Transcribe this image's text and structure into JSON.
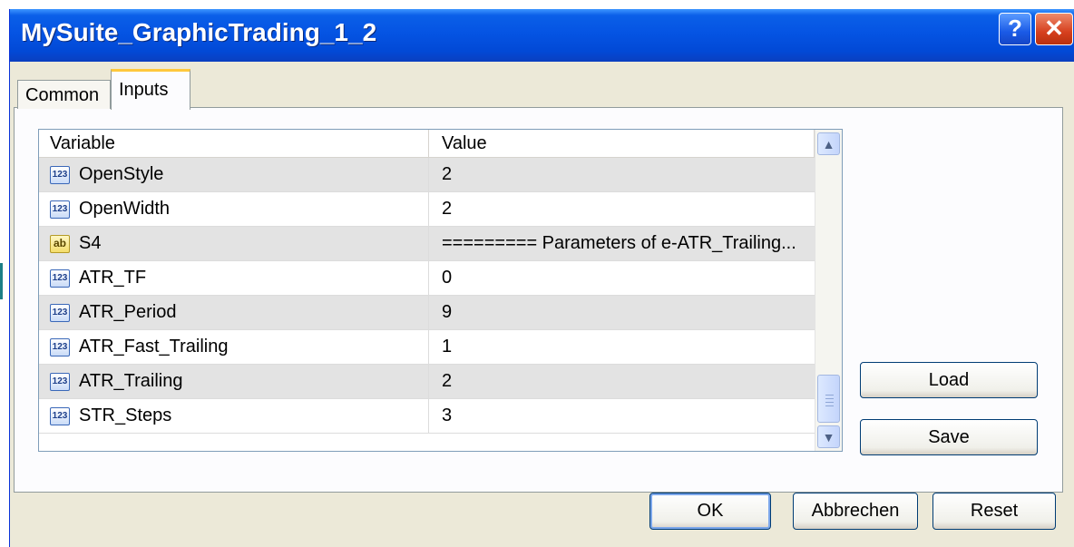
{
  "window": {
    "title": "MySuite_GraphicTrading_1_2"
  },
  "title_buttons": {
    "help": "?",
    "close": "✕"
  },
  "tabs": [
    {
      "label": "Common",
      "active": false
    },
    {
      "label": "Inputs",
      "active": true
    }
  ],
  "grid": {
    "columns": [
      "Variable",
      "Value"
    ],
    "rows": [
      {
        "icon": "123",
        "variable": "OpenStyle",
        "value": "2"
      },
      {
        "icon": "123",
        "variable": "OpenWidth",
        "value": "2"
      },
      {
        "icon": "ab",
        "variable": "S4",
        "value": "========= Parameters of e-ATR_Trailing..."
      },
      {
        "icon": "123",
        "variable": "ATR_TF",
        "value": "0"
      },
      {
        "icon": "123",
        "variable": "ATR_Period",
        "value": "9"
      },
      {
        "icon": "123",
        "variable": "ATR_Fast_Trailing",
        "value": "1"
      },
      {
        "icon": "123",
        "variable": "ATR_Trailing",
        "value": "2"
      },
      {
        "icon": "123",
        "variable": "STR_Steps",
        "value": "3"
      }
    ]
  },
  "buttons": {
    "load": "Load",
    "save": "Save",
    "ok": "OK",
    "cancel": "Abbrechen",
    "reset": "Reset"
  },
  "colors": {
    "titlebar": "#0554e3",
    "tab_highlight": "#ffc83c",
    "dialog_bg": "#ece9d8"
  }
}
